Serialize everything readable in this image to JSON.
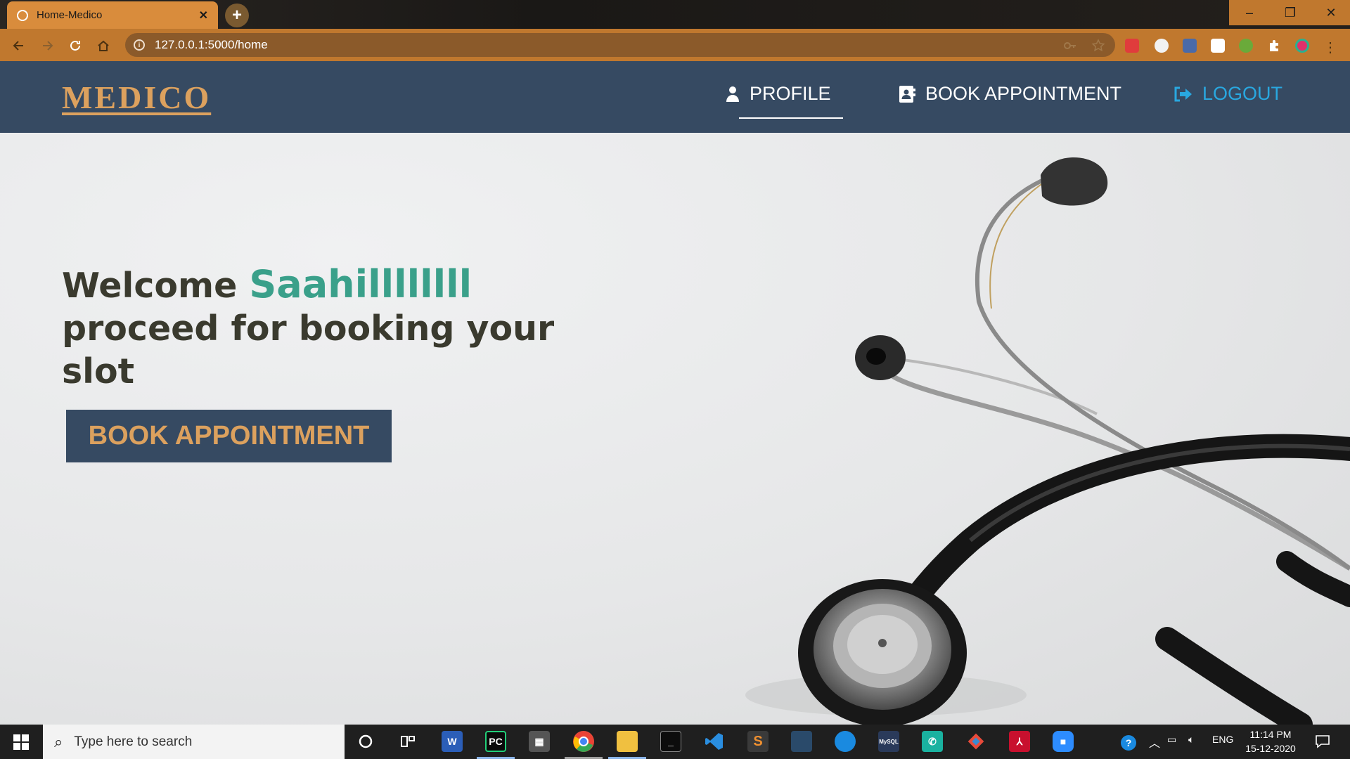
{
  "browser": {
    "tab_title": "Home-Medico",
    "tab_close": "✕",
    "new_tab": "+",
    "url": "127.0.0.1:5000/home",
    "window_controls": {
      "minimize": "–",
      "restore": "❐",
      "close": "✕"
    }
  },
  "navbar": {
    "logo": "MEDICO",
    "links": [
      {
        "label": "PROFILE",
        "icon": "user-icon",
        "active": true
      },
      {
        "label": "BOOK APPOINTMENT",
        "icon": "contact-book-icon",
        "active": false
      },
      {
        "label": "LOGOUT",
        "icon": "logout-icon",
        "active": false
      }
    ]
  },
  "hero": {
    "welcome_prefix": "Welcome ",
    "user_name": "Saahillllllll",
    "subtitle": "proceed for booking your slot",
    "cta_label": "BOOK APPOINTMENT"
  },
  "taskbar": {
    "search_placeholder": "Type here to search",
    "language": "ENG",
    "time": "11:14 PM",
    "date": "15-12-2020"
  },
  "colors": {
    "navbar_bg": "#364a62",
    "logo": "#dca15e",
    "accent_name": "#3aa08a",
    "logout": "#29a8e0",
    "browser_theme": "#c0782e"
  }
}
